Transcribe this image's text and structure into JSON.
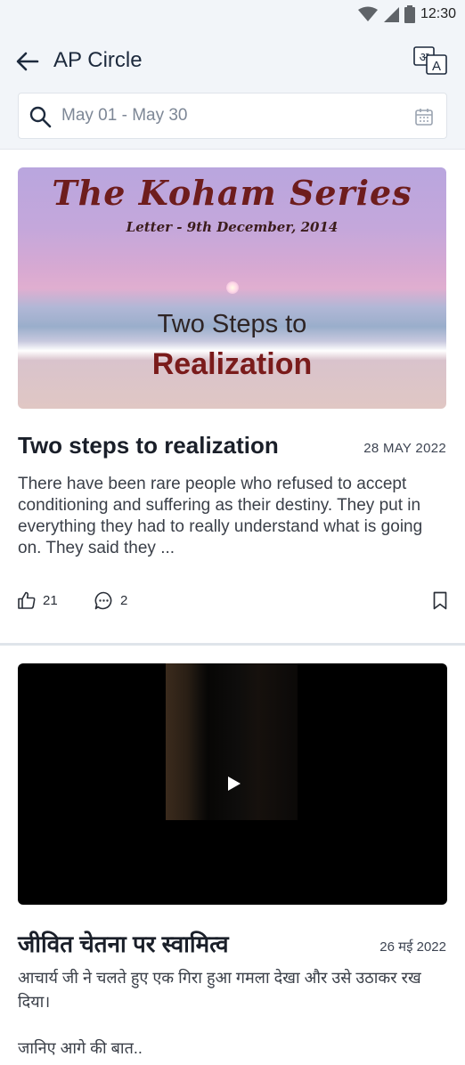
{
  "status_bar": {
    "time": "12:30",
    "icons": [
      "wifi-icon",
      "signal-icon",
      "battery-icon"
    ]
  },
  "header": {
    "title": "AP Circle",
    "back_icon": "arrow-left-icon",
    "translate_icon": "translate-icon"
  },
  "search": {
    "value": "May 01 - May 30",
    "search_icon": "search-icon",
    "calendar_icon": "calendar-icon"
  },
  "posts": [
    {
      "banner": {
        "title": "The Koham Series",
        "subtitle": "Letter - 9th December, 2014",
        "line1": "Two Steps to",
        "line2": "Realization"
      },
      "title": "Two steps to realization",
      "date": "28 MAY 2022",
      "excerpt": "There have been rare people who refused to accept conditioning and suffering as their destiny. They put in everything they had to really understand what is going on. They said they ...",
      "likes": "21",
      "comments": "2",
      "bookmark_icon": "bookmark-icon"
    },
    {
      "media": "video",
      "play_icon": "play-icon",
      "title": "जीवित चेतना पर स्वामित्व",
      "date": "26 मई 2022",
      "excerpt": "आचार्य जी ने चलते हुए एक गिरा हुआ गमला देखा और उसे उठाकर रख दिया।",
      "more": "जानिए आगे की बात.."
    }
  ],
  "colors": {
    "header_bg": "#f2f5f9",
    "title": "#1d2a3d",
    "banner_text": "#7a1b1b"
  }
}
